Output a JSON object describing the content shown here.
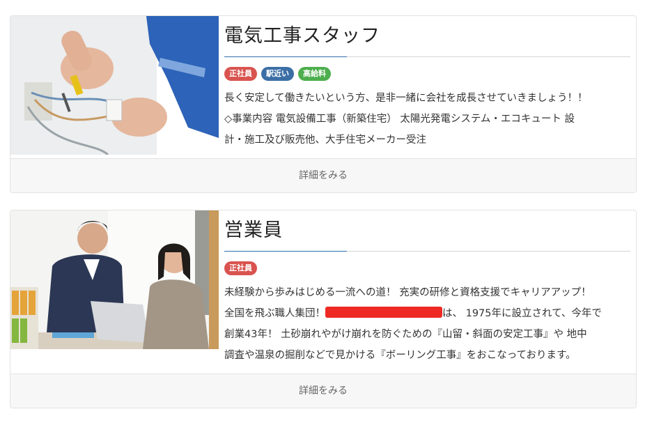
{
  "jobs": [
    {
      "title": "電気工事スタッフ",
      "badges": [
        "正社員",
        "駅近い",
        "高給料"
      ],
      "description_lines": [
        "長く安定して働きたいという方、是非一緒に会社を成長させていきましょう！！",
        "◇事業内容 電気設備工事（新築住宅） 太陽光発電システム・エコキュート 設",
        "計・施工及び販売他、大手住宅メーカー受注"
      ],
      "button_label": "詳細をみる"
    },
    {
      "title": "営業員",
      "badges": [
        "正社員"
      ],
      "description_lines": [
        "未経験から歩みはじめる一流への道！ 充実の研修と資格支援でキャリアアップ！",
        "全国を飛ぶ職人集団！",
        "は、 1975年に設立されて、今年で",
        "創業43年！ 土砂崩れやがけ崩れを防ぐための『山留・斜面の安定工事』や 地中",
        "調査や温泉の掘削などで見かける『ボーリング工事』をおこなっております。"
      ],
      "button_label": "詳細をみる"
    }
  ],
  "colors": {
    "badge_full_time": "#d9534f",
    "badge_station": "#3b6ea5",
    "badge_salary": "#4cae4c",
    "title_accent": "#2f6fae",
    "redaction": "#ee2a24"
  }
}
